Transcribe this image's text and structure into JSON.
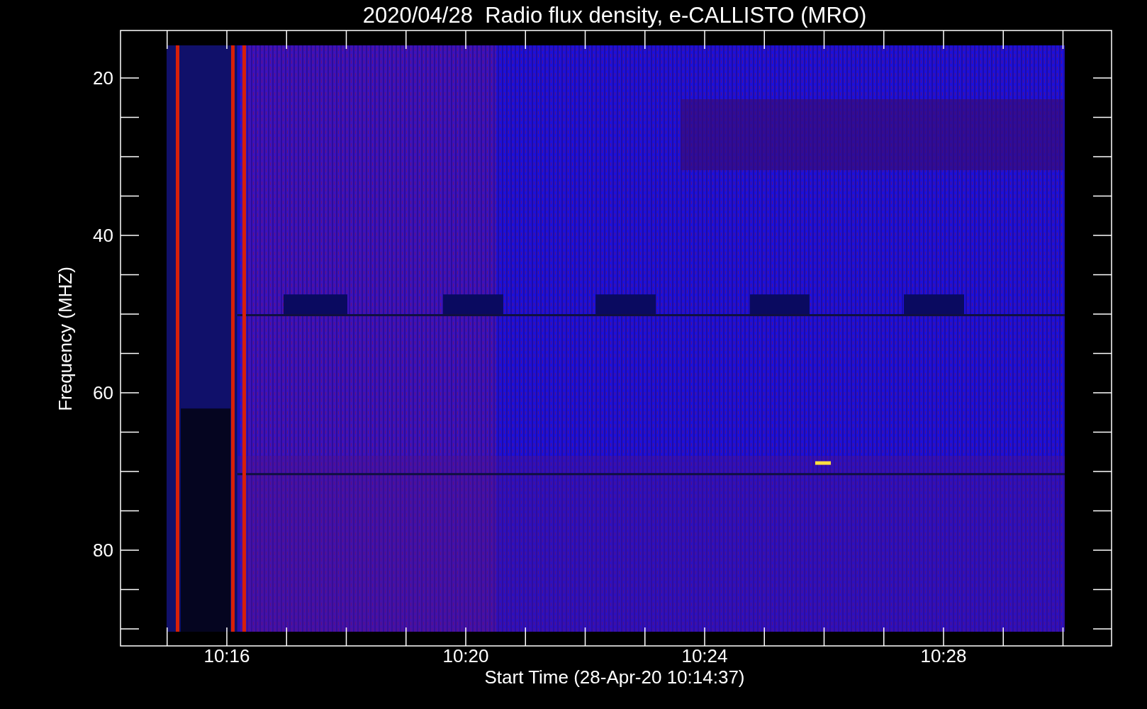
{
  "plot": {
    "title": "2020/04/28  Radio flux density, e-CALLISTO (MRO)",
    "ylabel": "Frequency (MHZ)",
    "xlabel": "Start Time (28-Apr-20 10:14:37)",
    "yticks": [
      "20",
      "40",
      "60",
      "80"
    ],
    "xticks": [
      "10:16",
      "10:20",
      "10:24",
      "10:28"
    ]
  }
}
